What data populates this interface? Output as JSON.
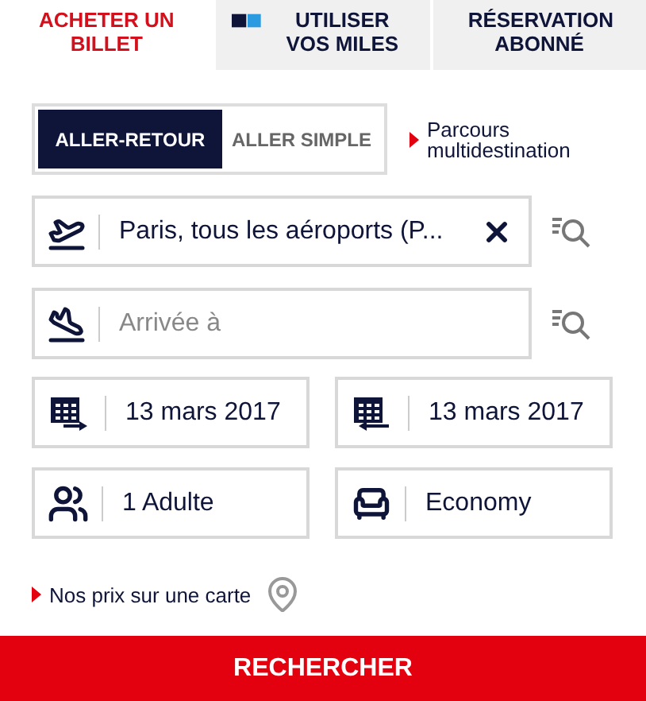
{
  "tabs": [
    {
      "label": "ACHETER UN BILLET",
      "selected": true,
      "kind": "plain"
    },
    {
      "label": "UTILISER VOS MILES",
      "selected": false,
      "kind": "miles"
    },
    {
      "label": "RÉSERVATION ABONNÉ",
      "selected": false,
      "kind": "plain"
    }
  ],
  "trip_types": [
    {
      "label": "ALLER-RETOUR",
      "selected": true
    },
    {
      "label": "ALLER SIMPLE",
      "selected": false
    }
  ],
  "multi_destination_link": "Parcours multidestination",
  "origin": {
    "value": "Paris, tous les aéroports (P..."
  },
  "destination": {
    "placeholder": "Arrivée à"
  },
  "dates": [
    {
      "kind": "outbound",
      "value": "13 mars 2017"
    },
    {
      "kind": "return",
      "value": "13 mars 2017"
    }
  ],
  "passengers": {
    "value": "1 Adulte"
  },
  "cabin": {
    "value": "Economy"
  },
  "map_link": "Nos prix sur une carte",
  "search_button": "RECHERCHER"
}
